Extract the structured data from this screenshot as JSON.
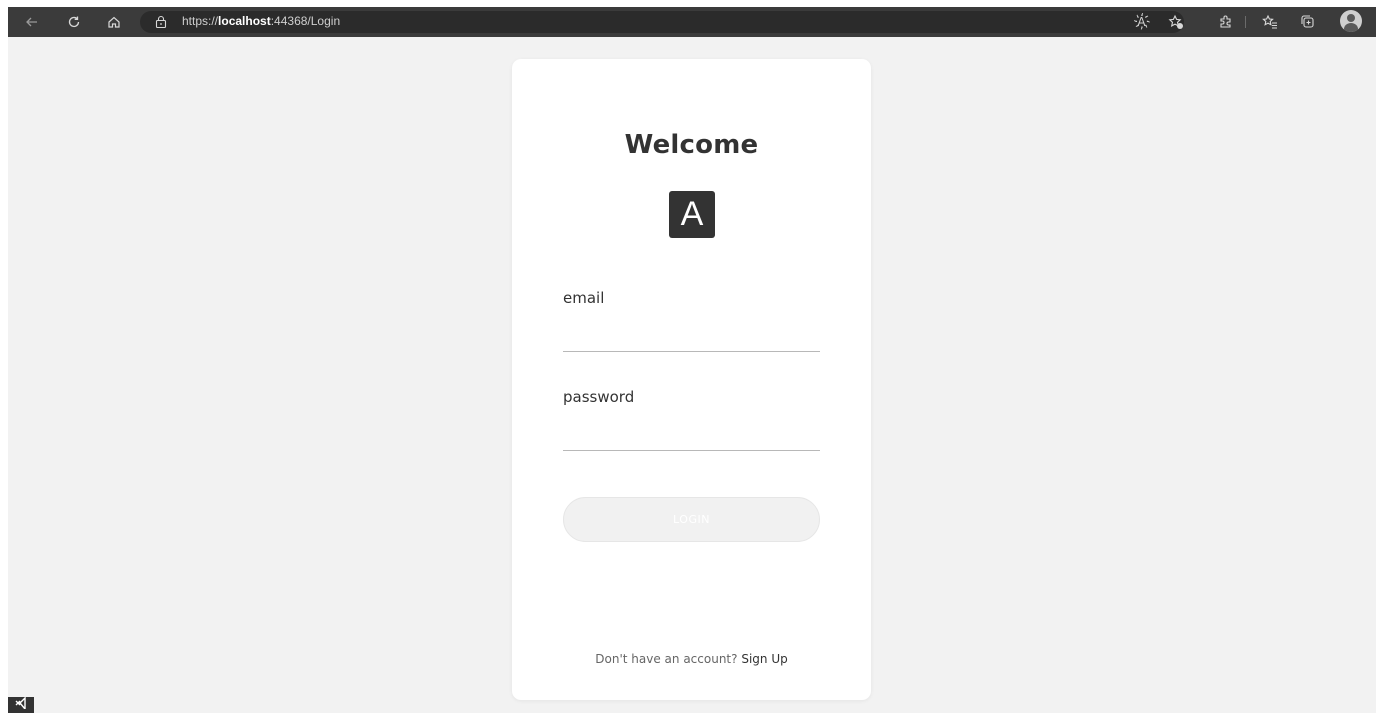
{
  "browser": {
    "url_prefix": "https://",
    "url_host": "localhost",
    "url_rest": ":44368/Login",
    "read_aloud_label": "A҉"
  },
  "login": {
    "title": "Welcome",
    "logo_letter": "A",
    "email_label": "email",
    "email_value": "",
    "password_label": "password",
    "password_value": "",
    "button_label": "LOGIN",
    "footer_text": "Don't have an account?",
    "signup_link": "Sign Up"
  },
  "colors": {
    "page_background": "#f2f2f2",
    "card_background": "#ffffff",
    "text_dark": "#333333",
    "button_disabled": "#f1f1f1",
    "browser_bar": "#3b3b3b"
  },
  "icons": {
    "back": "back-arrow-icon",
    "refresh": "refresh-icon",
    "home": "home-icon",
    "site_info": "lock-icon",
    "favorites_add": "add-favorite-icon",
    "extensions": "puzzle-icon",
    "favorites": "favorites-icon",
    "collections": "collections-icon",
    "profile": "profile-icon",
    "taskbar": "visual-studio-icon"
  }
}
